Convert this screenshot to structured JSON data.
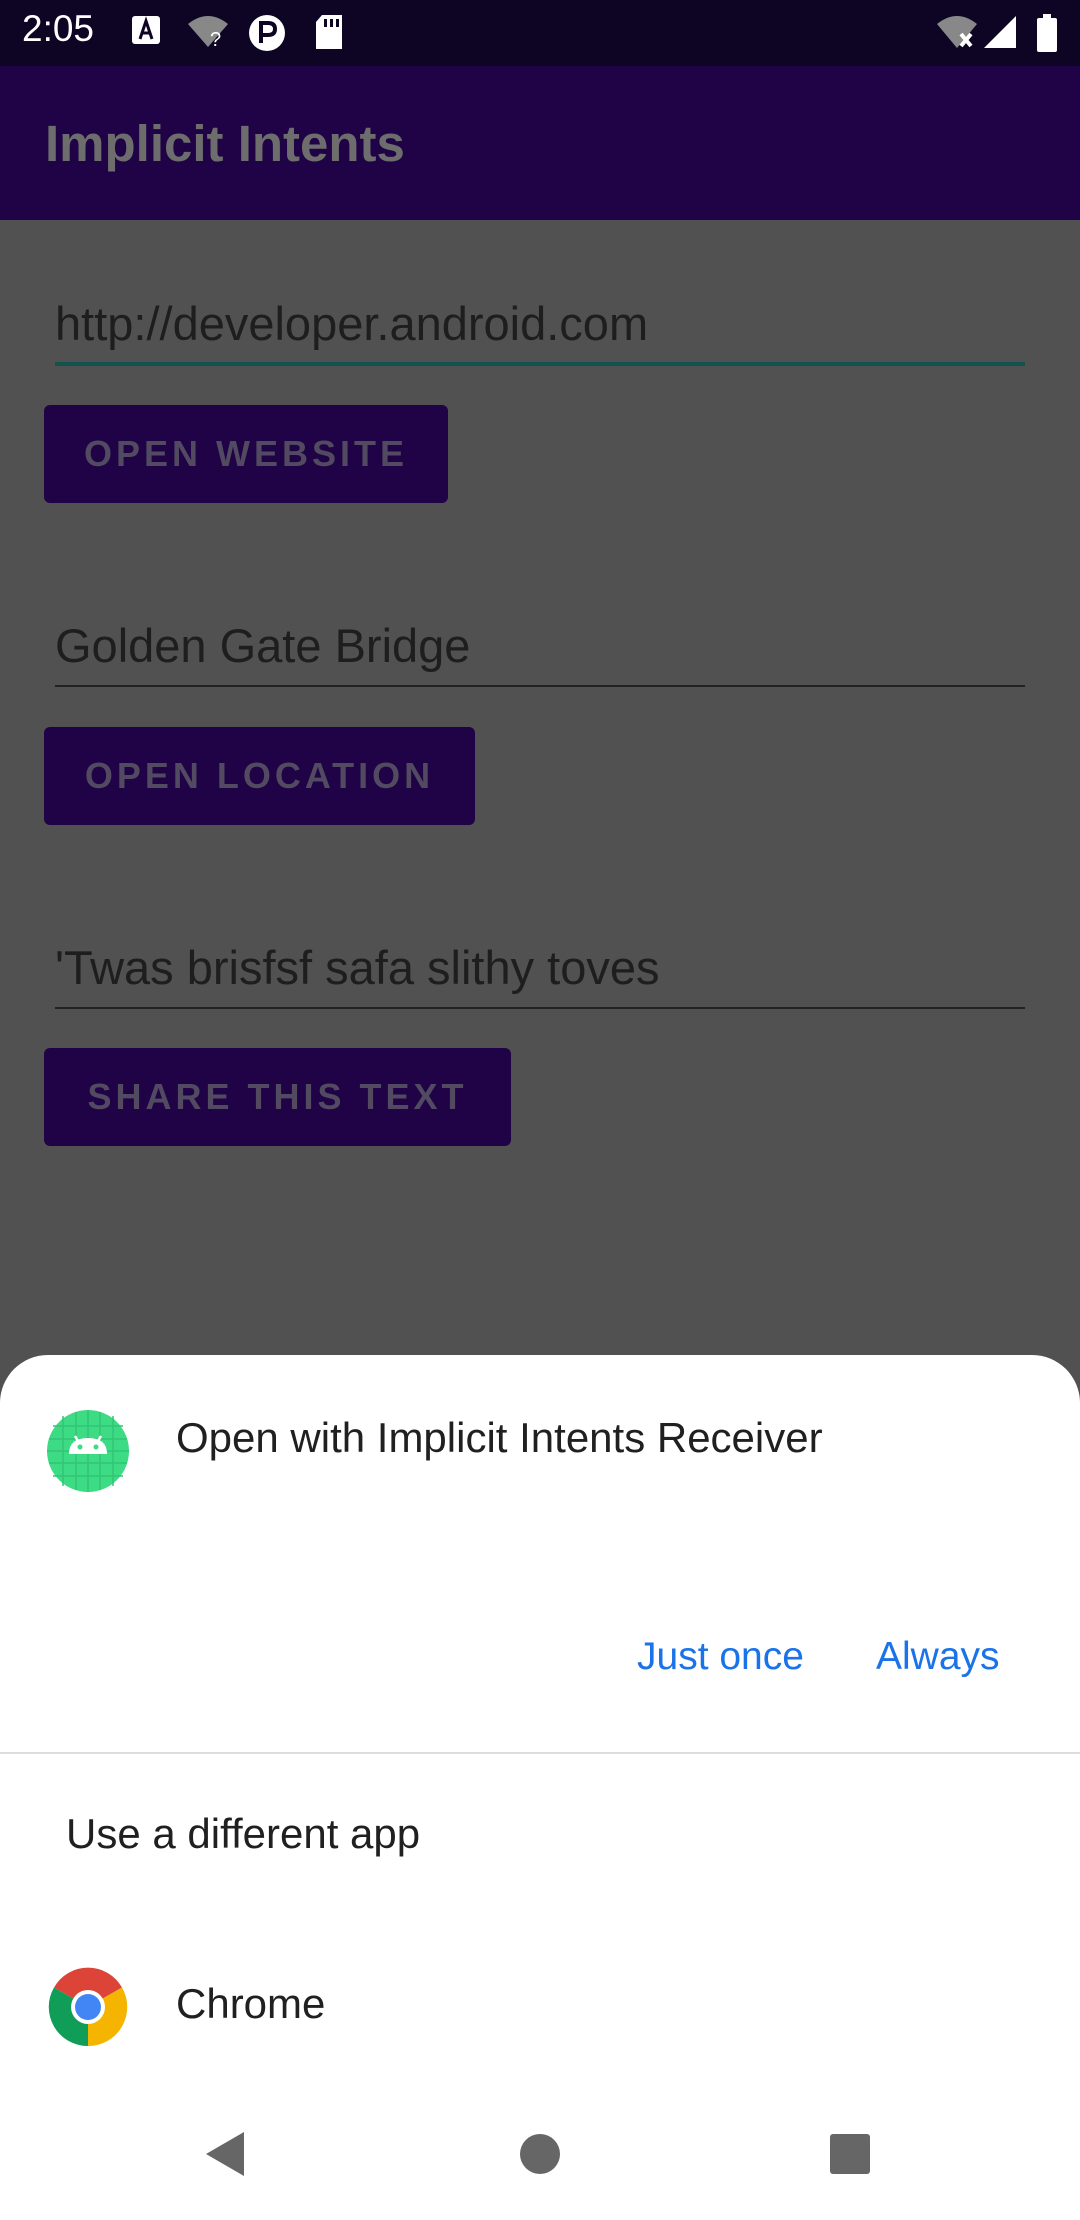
{
  "status_bar": {
    "time": "2:05",
    "left_icons": [
      "a-notification-icon",
      "wifi-question-icon",
      "p-app-icon",
      "sd-card-icon"
    ],
    "right_icons": [
      "wifi-off-icon",
      "cellular-signal-icon",
      "battery-icon"
    ]
  },
  "app_bar": {
    "title": "Implicit Intents"
  },
  "main": {
    "website_field_value": "http://developer.android.com",
    "open_website_label": "OPEN WEBSITE",
    "location_field_value": "Golden Gate Bridge",
    "open_location_label": "OPEN LOCATION",
    "share_field_value": "'Twas brisfsf safa slithy toves",
    "share_text_label": "SHARE THIS TEXT"
  },
  "sheet": {
    "title": "Open with Implicit Intents Receiver",
    "app_icon": "android-app-icon",
    "just_once_label": "Just once",
    "always_label": "Always",
    "different_app_label": "Use a different app",
    "apps": [
      {
        "name": "Chrome",
        "icon": "chrome-icon"
      }
    ]
  },
  "nav_bar": {
    "icons": [
      "back-icon",
      "home-icon",
      "recents-icon"
    ]
  },
  "colors": {
    "accent": "#1a73e8",
    "primary_dark": "#1f0346",
    "scrim": "#515151"
  }
}
